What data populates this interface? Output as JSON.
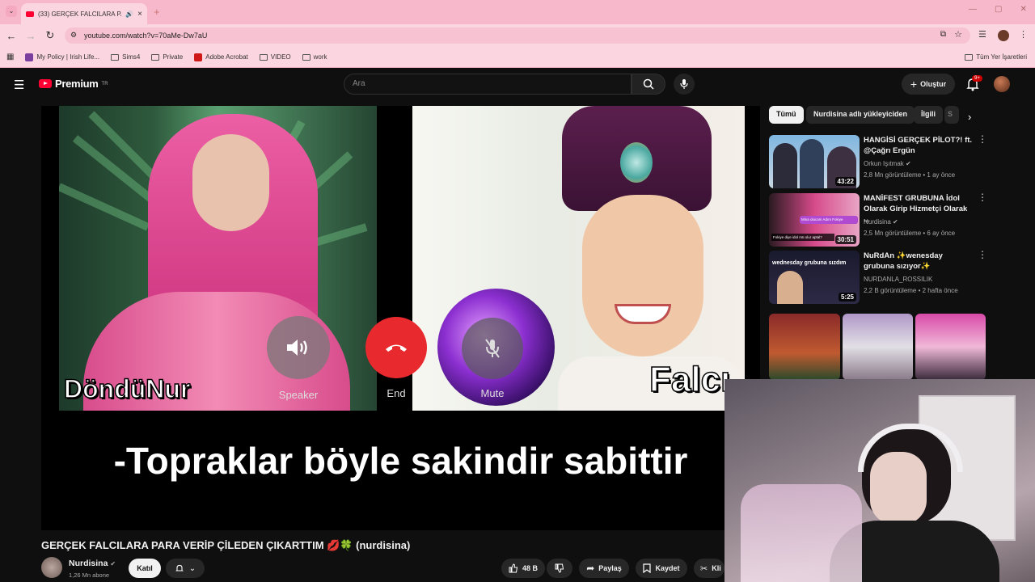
{
  "browser": {
    "tab_title": "(33) GERÇEK FALCILARA PA",
    "url": "youtube.com/watch?v=70aMe-Dw7aU",
    "bookmarks": [
      "My Policy | Irish Life...",
      "Sims4",
      "Private",
      "Adobe Acrobat",
      "VIDEO",
      "work"
    ],
    "all_bookmarks": "Tüm Yer İşaretleri"
  },
  "youtube": {
    "logo_text": "Premium",
    "logo_sup": "TR",
    "search_placeholder": "Ara",
    "create_label": "Oluştur",
    "notif_count": "9+"
  },
  "player": {
    "left_name": "DöndüNur",
    "right_name": "Falcı",
    "speaker_label": "Speaker",
    "end_label": "End",
    "mute_label": "Mute",
    "subtitle": "-Topraklar böyle sakindir sabittir"
  },
  "chips": [
    "Tümü",
    "Nurdisina adlı yükleyiciden",
    "İlgili",
    "S"
  ],
  "recommendations": [
    {
      "title": "HANGİSİ GERÇEK PİLOT?! ft. @Çağrı Ergün",
      "channel": "Orkun Işıtmak",
      "meta": "2,8 Mn görüntüleme • 1 ay önce",
      "duration": "43:22"
    },
    {
      "title": "MANİFEST GRUBUNA İdol Olarak Girip Hizmetçi Olarak ...",
      "channel": "Nurdisina",
      "meta": "2,5 Mn görüntüleme • 6 ay önce",
      "duration": "30:51"
    },
    {
      "title": "NuRdAn ✨wenesday grubuna sızıyor✨",
      "channel": "NURDANLA_ROSSILIK",
      "meta": "2,2 B görüntüleme • 2 hafta önce",
      "duration": "5:25"
    }
  ],
  "thumb_texts": {
    "rec2_overlay": "Fokiye diye idol mü olur aptal?",
    "rec3_overlay": "wednesday grubuna sızdım"
  },
  "video": {
    "title": "GERÇEK FALCILARA PARA VERİP ÇİLEDEN ÇIKARTTIM 💋🍀 (nurdisina)",
    "channel": "Nurdisina",
    "subscribers": "1,26 Mn abone",
    "join_label": "Katıl",
    "likes": "48 B",
    "share_label": "Paylaş",
    "save_label": "Kaydet",
    "clip_label": "Kli"
  }
}
